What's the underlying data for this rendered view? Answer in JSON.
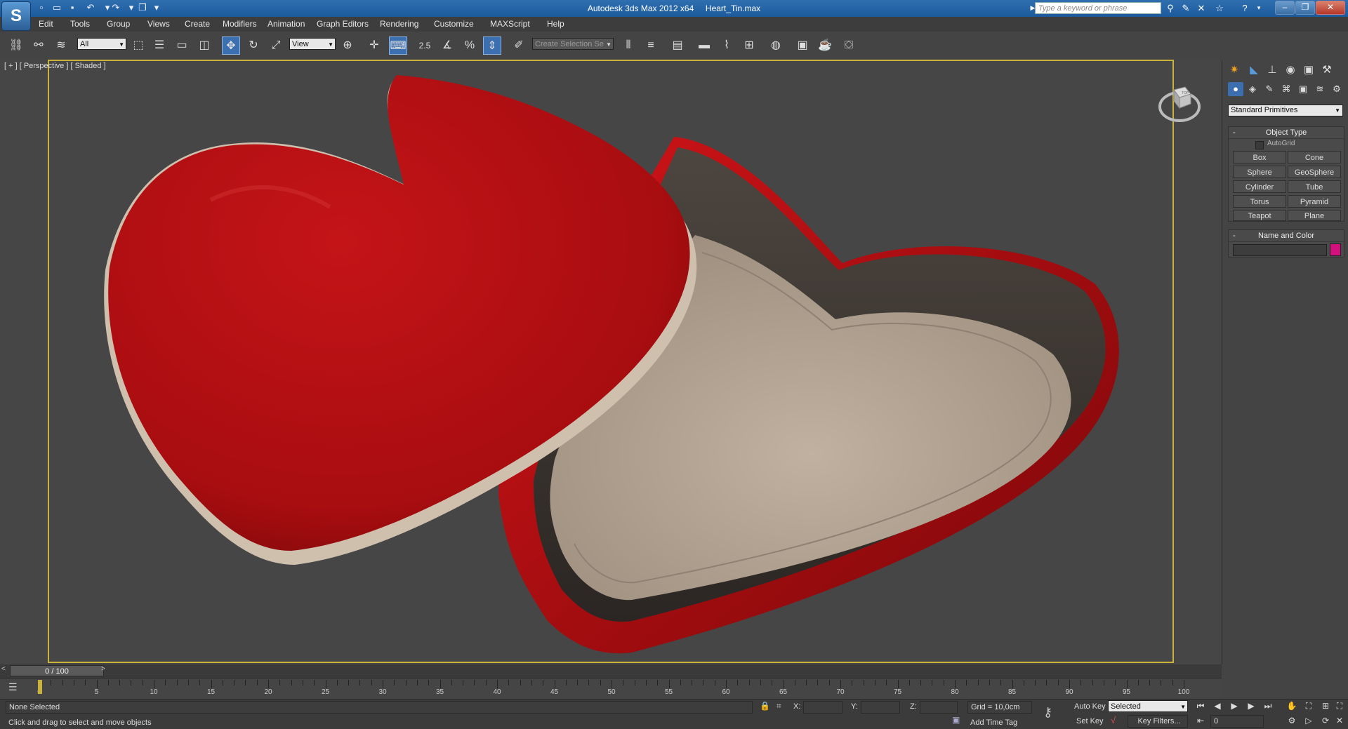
{
  "window": {
    "title": "Autodesk 3ds Max  2012 x64",
    "file": "Heart_Tin.max"
  },
  "app_logo": {
    "glyph": "S",
    "icon": "3dsmax-logo-icon"
  },
  "search": {
    "placeholder": "Type a keyword or phrase"
  },
  "menu": [
    "Edit",
    "Tools",
    "Group",
    "Views",
    "Create",
    "Modifiers",
    "Animation",
    "Graph Editors",
    "Rendering",
    "Customize",
    "MAXScript",
    "Help"
  ],
  "toolbar": {
    "selection_filter": "All",
    "coord_system": "View",
    "snap_angle": "2.5",
    "named_selection_placeholder": "Create Selection Se"
  },
  "viewport": {
    "label": "[ + ] [ Perspective ] [ Shaded ]"
  },
  "viewcube": {
    "face_label": "TOP"
  },
  "command_panel": {
    "category": "Standard Primitives",
    "object_type": {
      "title": "Object Type",
      "autogrid": "AutoGrid",
      "buttons": [
        "Box",
        "Cone",
        "Sphere",
        "GeoSphere",
        "Cylinder",
        "Tube",
        "Torus",
        "Pyramid",
        "Teapot",
        "Plane"
      ]
    },
    "name_color": {
      "title": "Name and Color",
      "swatch_color": "#d4107e"
    }
  },
  "timeline": {
    "slider_label": "0 / 100",
    "ruler_labels": [
      "0",
      "5",
      "10",
      "15",
      "20",
      "25",
      "30",
      "35",
      "40",
      "45",
      "50",
      "55",
      "60",
      "65",
      "70",
      "75",
      "80",
      "85",
      "90",
      "95",
      "100"
    ]
  },
  "status": {
    "selection": "None Selected",
    "prompt": "Click and drag to select and move objects",
    "x_label": "X:",
    "y_label": "Y:",
    "z_label": "Z:",
    "grid": "Grid = 10,0cm",
    "add_time_tag": "Add Time Tag",
    "auto_key": "Auto Key",
    "set_key": "Set Key",
    "key_mode": "Selected",
    "key_filters": "Key Filters...",
    "current_frame": "0"
  },
  "colors": {
    "lid_red": "#b30e12",
    "tin_inner": "#b8a998",
    "viewport_border": "#c9b33a",
    "active_blue": "#3b6fb0"
  }
}
